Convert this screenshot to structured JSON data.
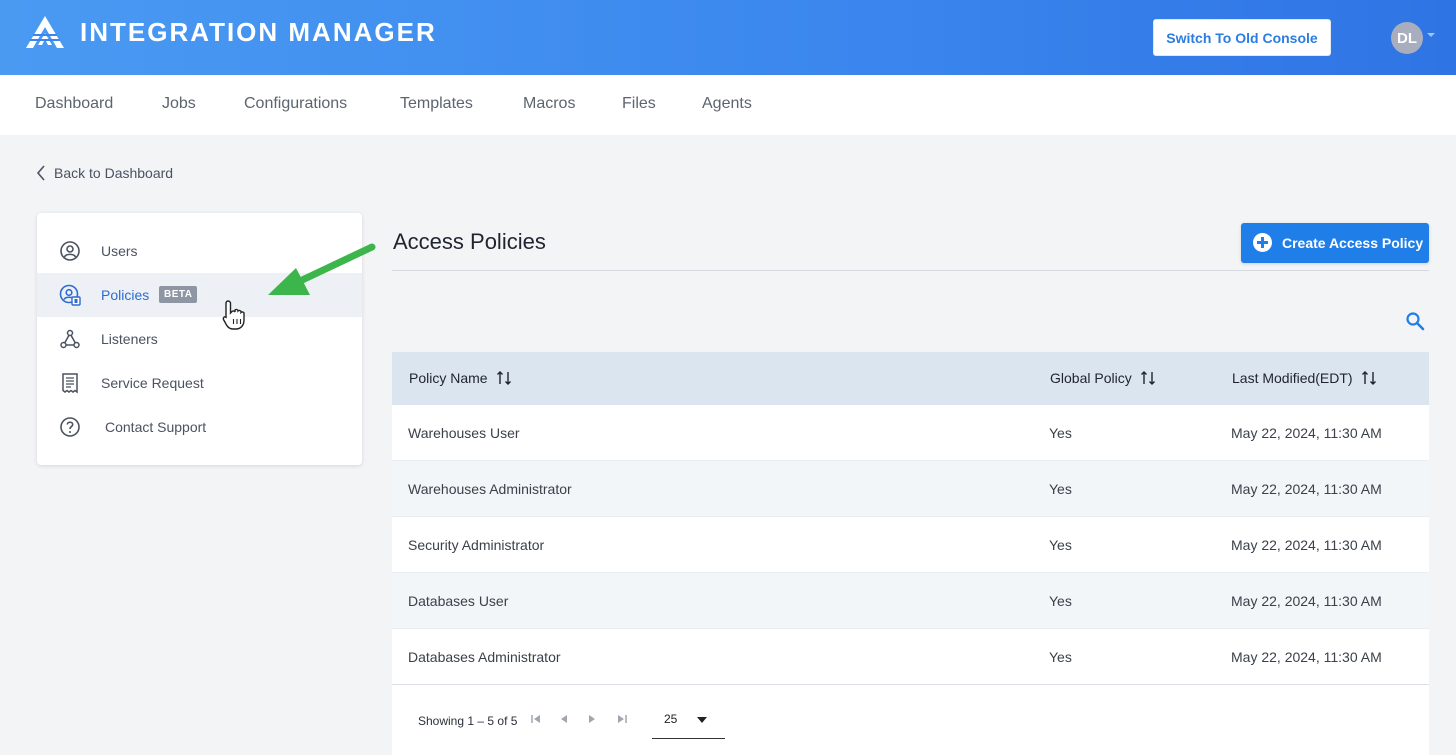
{
  "header": {
    "title": "INTEGRATION MANAGER",
    "switch_button": "Switch To Old Console",
    "avatar_initials": "DL",
    "gradient_start": "#4a9af2",
    "gradient_end": "#2f74e4"
  },
  "nav": {
    "items": [
      "Dashboard",
      "Jobs",
      "Configurations",
      "Templates",
      "Macros",
      "Files",
      "Agents"
    ]
  },
  "back_link": "Back to Dashboard",
  "sidebar": {
    "items": [
      {
        "label": "Users",
        "icon": "user-circle-icon"
      },
      {
        "label": "Policies",
        "icon": "user-shield-icon",
        "badge": "BETA",
        "active": true
      },
      {
        "label": "Listeners",
        "icon": "webhook-icon"
      },
      {
        "label": "Service Request",
        "icon": "receipt-icon"
      },
      {
        "label": "Contact Support",
        "icon": "help-circle-icon"
      }
    ]
  },
  "main": {
    "title": "Access Policies",
    "create_button": "Create Access Policy",
    "accent_color": "#1f7ee8",
    "table": {
      "columns": [
        "Policy Name",
        "Global Policy",
        "Last Modified(EDT)"
      ],
      "rows": [
        [
          "Warehouses User",
          "Yes",
          "May 22, 2024, 11:30 AM"
        ],
        [
          "Warehouses Administrator",
          "Yes",
          "May 22, 2024, 11:30 AM"
        ],
        [
          "Security Administrator",
          "Yes",
          "May 22, 2024, 11:30 AM"
        ],
        [
          "Databases User",
          "Yes",
          "May 22, 2024, 11:30 AM"
        ],
        [
          "Databases Administrator",
          "Yes",
          "May 22, 2024, 11:30 AM"
        ]
      ]
    },
    "pagination": {
      "showing": "Showing 1 – 5 of 5",
      "per_page": "25"
    }
  },
  "annotation": {
    "arrow_color": "#3cb54a"
  }
}
